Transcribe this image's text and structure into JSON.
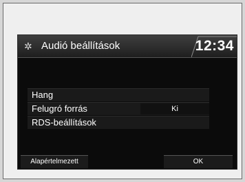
{
  "header": {
    "icon": "gear-icon",
    "title": "Audió beállítások",
    "clock": "12:34"
  },
  "menu": {
    "items": [
      {
        "label": "Hang",
        "value": ""
      },
      {
        "label": "Felugró forrás",
        "value": "Ki"
      },
      {
        "label": "RDS-beállítások",
        "value": ""
      }
    ]
  },
  "footer": {
    "default_label": "Alapértelmezett",
    "ok_label": "OK"
  }
}
